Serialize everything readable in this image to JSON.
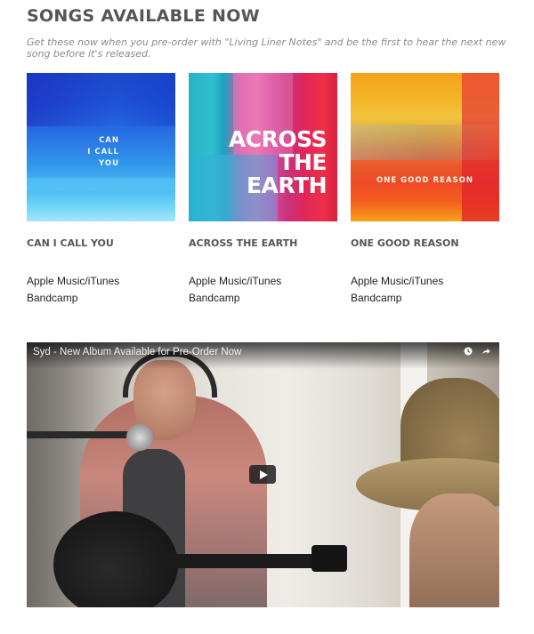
{
  "section": {
    "heading": "SONGS AVAILABLE NOW",
    "subtitle": "Get these now when you pre-order with \"Living Liner Notes\" and be the first to hear the next new song before it's released."
  },
  "albums": [
    {
      "cover_text": "CAN I CALL YOU",
      "cover_lines": [
        "CAN",
        "I CALL",
        "YOU"
      ],
      "title": "CAN I CALL YOU",
      "links": [
        "Apple Music/iTunes",
        "Bandcamp"
      ]
    },
    {
      "cover_text": "ACROSS THE EARTH",
      "cover_lines": [
        "ACROSS",
        "THE",
        "EARTH"
      ],
      "title": "ACROSS THE EARTH",
      "links": [
        "Apple Music/iTunes",
        "Bandcamp"
      ]
    },
    {
      "cover_text": "ONE GOOD REASON",
      "cover_lines": [
        "ONE GOOD REASON"
      ],
      "title": "ONE GOOD REASON",
      "links": [
        "Apple Music/iTunes",
        "Bandcamp"
      ]
    }
  ],
  "video": {
    "title": "Syd - New Album Available for Pre-Order Now",
    "icons": [
      "watch-later-icon",
      "share-icon",
      "play-icon"
    ]
  },
  "colors": {
    "heading": "#555555",
    "subtitle": "#8a8a8a",
    "link": "#222222"
  }
}
